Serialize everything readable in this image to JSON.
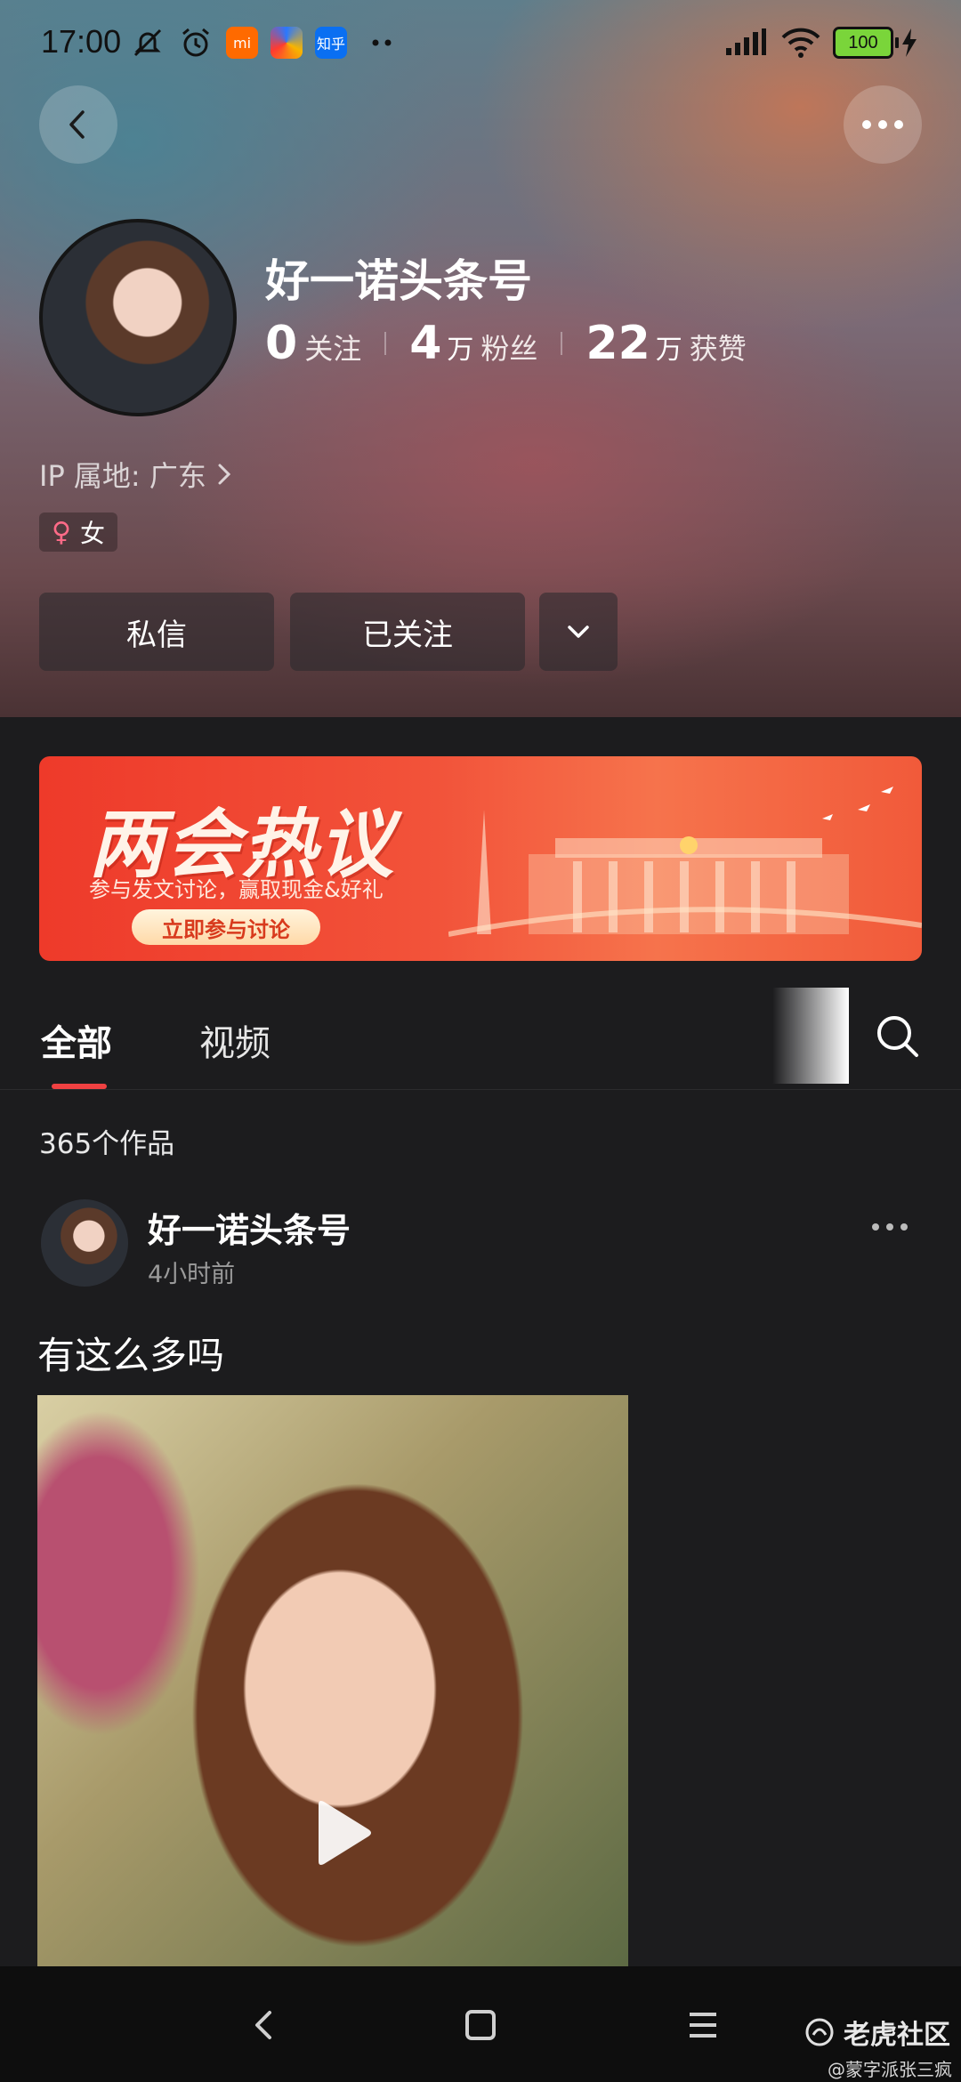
{
  "status_bar": {
    "time": "17:00",
    "battery": "100",
    "app_badges": {
      "mi": "mi",
      "zhihu": "知乎"
    }
  },
  "profile": {
    "name": "好一诺头条号",
    "stats": [
      {
        "num": "0",
        "unit": "",
        "label": "关注"
      },
      {
        "num": "4",
        "unit": "万",
        "label": "粉丝"
      },
      {
        "num": "22",
        "unit": "万",
        "label": "获赞"
      }
    ],
    "ip_location": "IP 属地: 广东",
    "gender_icon": "♀",
    "gender": "女",
    "actions": {
      "message": "私信",
      "follow": "已关注"
    }
  },
  "banner": {
    "title": "两会热议",
    "subtitle": "参与发文讨论，赢取现金&好礼",
    "cta": "立即参与讨论"
  },
  "tabs": [
    {
      "label": "全部",
      "active": true
    },
    {
      "label": "视频",
      "active": false
    }
  ],
  "works_count": "365个作品",
  "post": {
    "author": "好一诺头条号",
    "time": "4小时前",
    "title": "有这么多吗"
  },
  "watermark": {
    "name": "老虎社区",
    "handle": "@蒙字派张三疯"
  },
  "colors": {
    "accent_red": "#f04142",
    "background": "#1c1c1e",
    "banner_red": "#ee3a2a"
  }
}
